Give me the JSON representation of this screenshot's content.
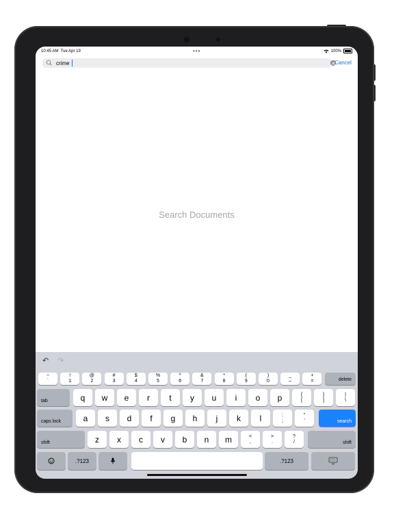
{
  "status": {
    "time": "10:45 AM",
    "date": "Tue Apr 19",
    "battery": "100%"
  },
  "search": {
    "value": "crime",
    "cancel_label": "Cancel"
  },
  "content": {
    "message": "Search Documents"
  },
  "keyboard": {
    "number_row": [
      {
        "top": "~",
        "bottom": "`"
      },
      {
        "top": "!",
        "bottom": "1"
      },
      {
        "top": "@",
        "bottom": "2"
      },
      {
        "top": "#",
        "bottom": "3"
      },
      {
        "top": "$",
        "bottom": "4"
      },
      {
        "top": "%",
        "bottom": "5"
      },
      {
        "top": "^",
        "bottom": "6"
      },
      {
        "top": "&",
        "bottom": "7"
      },
      {
        "top": "*",
        "bottom": "8"
      },
      {
        "top": "(",
        "bottom": "9"
      },
      {
        "top": ")",
        "bottom": "0"
      },
      {
        "top": "_",
        "bottom": "–"
      },
      {
        "top": "+",
        "bottom": "="
      }
    ],
    "delete_label": "delete",
    "row_q": [
      "q",
      "w",
      "e",
      "r",
      "t",
      "y",
      "u",
      "i",
      "o",
      "p"
    ],
    "row_q_extra": [
      {
        "top": "{",
        "bottom": "["
      },
      {
        "top": "}",
        "bottom": "]"
      },
      {
        "top": "|",
        "bottom": "\\"
      }
    ],
    "tab_label": "tab",
    "row_a": [
      "a",
      "s",
      "d",
      "f",
      "g",
      "h",
      "j",
      "k",
      "l"
    ],
    "row_a_extra": [
      {
        "top": ":",
        "bottom": ";"
      },
      {
        "top": "\"",
        "bottom": "'"
      }
    ],
    "caps_label": "caps lock",
    "search_label": "search",
    "row_z": [
      "z",
      "x",
      "c",
      "v",
      "b",
      "n",
      "m"
    ],
    "row_z_extra": [
      {
        "top": "<",
        "bottom": ","
      },
      {
        "top": ">",
        "bottom": "."
      },
      {
        "top": "?",
        "bottom": "/"
      }
    ],
    "shift_label": "shift",
    "numbers_label": ".?123",
    "emoji_icon": "emoji-icon",
    "mic_icon": "microphone-icon",
    "hide_icon": "keyboard-hide-icon"
  }
}
